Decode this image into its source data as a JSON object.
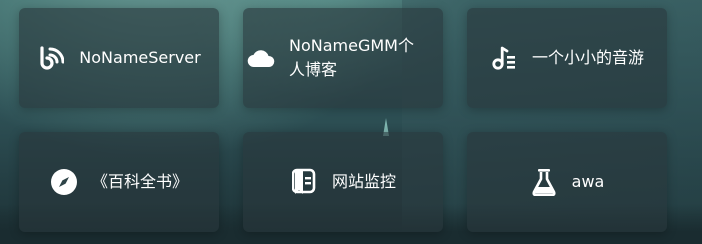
{
  "links": [
    {
      "label": "NoNameServer",
      "icon": "blog-rss-icon"
    },
    {
      "label": "NoNameGMM个人博客",
      "icon": "cloud-icon"
    },
    {
      "label": "一个小小的音游",
      "icon": "music-playlist-icon"
    },
    {
      "label": "《百科全书》",
      "icon": "compass-icon"
    },
    {
      "label": "网站监控",
      "icon": "monitor-book-icon"
    },
    {
      "label": "awa",
      "icon": "flask-icon"
    }
  ]
}
